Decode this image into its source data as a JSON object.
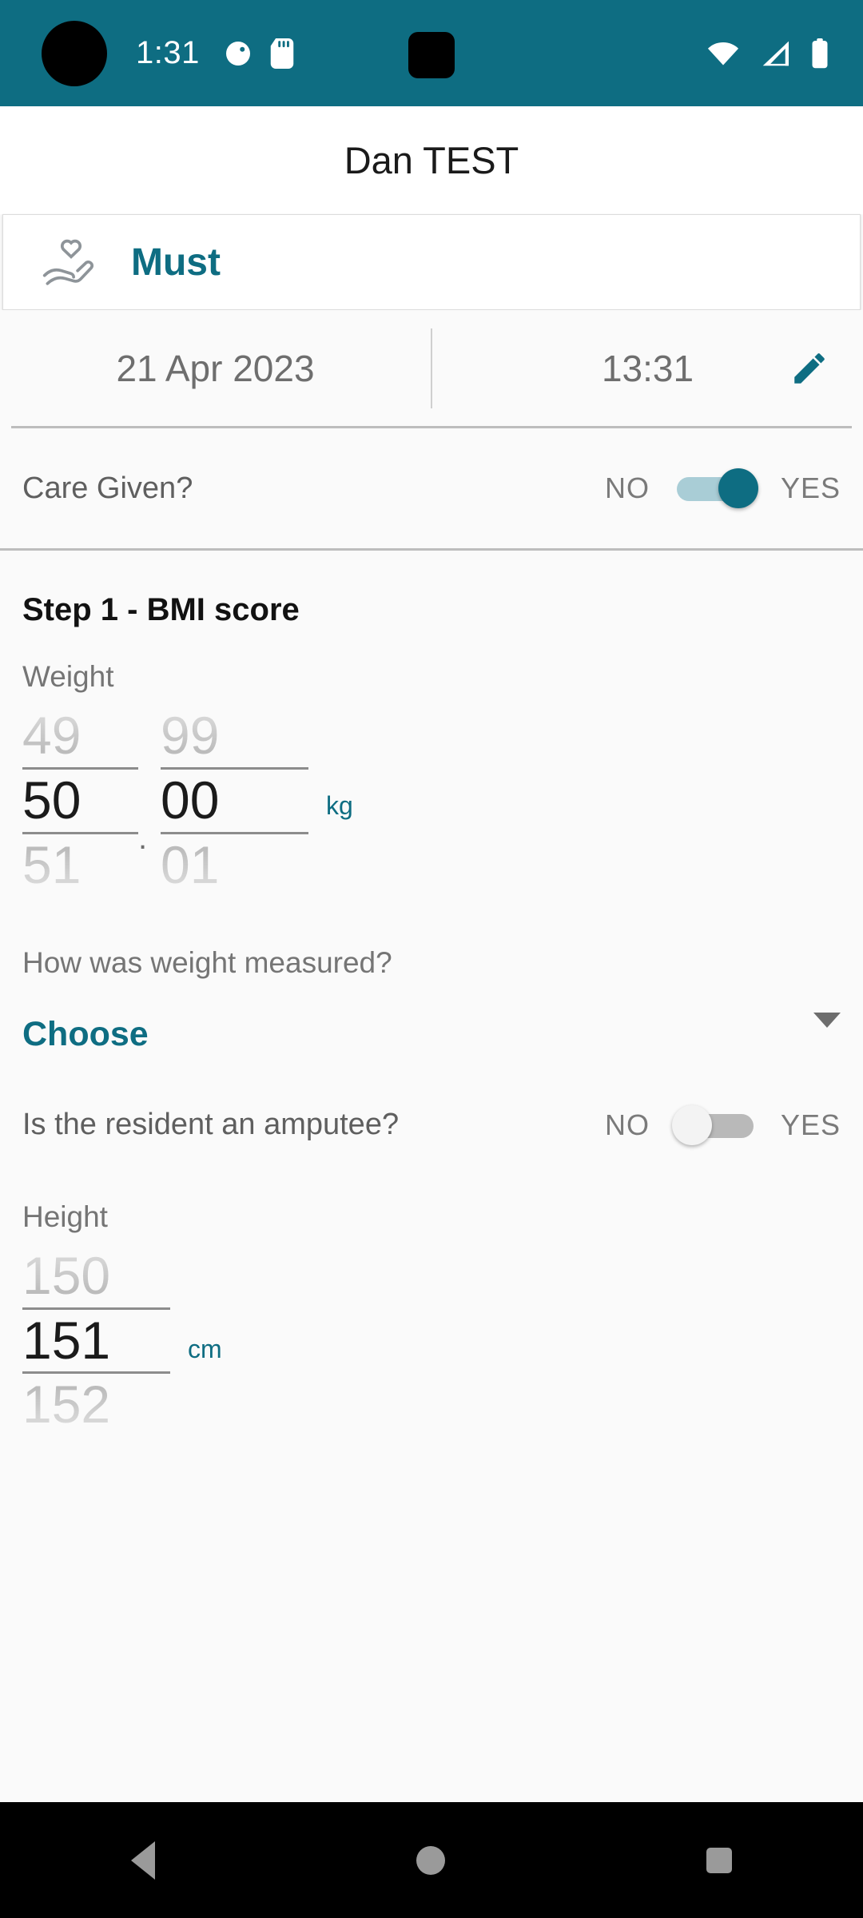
{
  "status_bar": {
    "time": "1:31",
    "icons": [
      "app-circle-icon",
      "sd-card-icon"
    ],
    "right_icons": [
      "wifi-icon",
      "cellular-signal-icon",
      "battery-icon"
    ],
    "background_color": "#0e6d82"
  },
  "header": {
    "title": "Dan TEST"
  },
  "assessment_card": {
    "icon": "heart-in-hand-icon",
    "label": "Must"
  },
  "record": {
    "date": "21 Apr 2023",
    "time": "13:31",
    "edit_icon": "pencil-icon"
  },
  "care_given": {
    "label": "Care Given?",
    "off_label": "NO",
    "on_label": "YES",
    "value": "YES"
  },
  "step1": {
    "title": "Step 1 - BMI score",
    "weight": {
      "label": "Weight",
      "whole_prev": "49",
      "whole_selected": "50",
      "whole_next": "51",
      "decimal_prev": "99",
      "decimal_selected": "00",
      "decimal_next": "01",
      "separator": ".",
      "unit": "kg"
    },
    "weight_method": {
      "label": "How was weight measured?",
      "value": "Choose",
      "arrow_icon": "chevron-down-icon"
    },
    "amputee": {
      "label": "Is the resident an amputee?",
      "off_label": "NO",
      "on_label": "YES",
      "value": "NO"
    },
    "height": {
      "label": "Height",
      "prev": "150",
      "selected": "151",
      "next": "152",
      "unit": "cm"
    }
  },
  "nav_bar": {
    "back": "back-icon",
    "home": "home-icon",
    "recents": "recents-icon"
  },
  "colors": {
    "accent_teal": "#0e6d82",
    "page_bg": "#fafafa",
    "divider": "#bdbdbd"
  }
}
